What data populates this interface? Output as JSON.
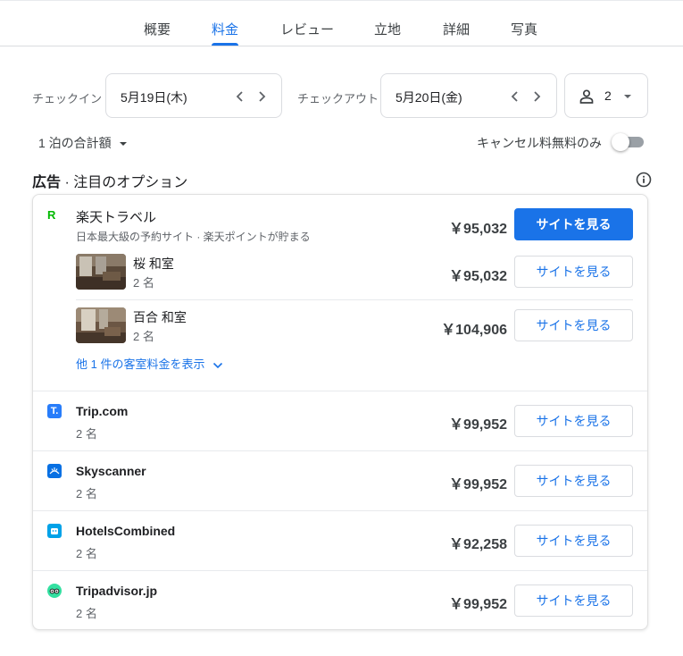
{
  "tabs": [
    {
      "label": "概要"
    },
    {
      "label": "料金"
    },
    {
      "label": "レビュー"
    },
    {
      "label": "立地"
    },
    {
      "label": "詳細"
    },
    {
      "label": "写真"
    }
  ],
  "dates": {
    "checkin_label": "チェックイン",
    "checkin_value": "5月19日(木)",
    "checkout_label": "チェックアウト",
    "checkout_value": "5月20日(金)"
  },
  "guests": {
    "count": "2"
  },
  "filters": {
    "total_label": "1 泊の合計額",
    "cancel_label": "キャンセル料無料のみ",
    "cancel_enabled": false
  },
  "section": {
    "ad_label": "広告",
    "separator": " · ",
    "title": "注目のオプション"
  },
  "featured": {
    "name": "楽天トラベル",
    "tagline": "日本最大級の予約サイト · 楽天ポイントが貯まる",
    "price": "￥95,032",
    "button": "サイトを見る",
    "rooms": [
      {
        "name": "桜 和室",
        "guests": "2 名",
        "price": "￥95,032",
        "button": "サイトを見る"
      },
      {
        "name": "百合 和室",
        "guests": "2 名",
        "price": "￥104,906",
        "button": "サイトを見る"
      }
    ],
    "more_link": "他 1 件の客室料金を表示"
  },
  "providers": [
    {
      "name": "Trip.com",
      "guests": "2 名",
      "price": "￥99,952",
      "button": "サイトを見る",
      "logo_color": "#287dfa"
    },
    {
      "name": "Skyscanner",
      "guests": "2 名",
      "price": "￥99,952",
      "button": "サイトを見る",
      "logo_color": "#0770e3"
    },
    {
      "name": "HotelsCombined",
      "guests": "2 名",
      "price": "￥92,258",
      "button": "サイトを見る",
      "logo_color": "#00a2e8"
    },
    {
      "name": "Tripadvisor.jp",
      "guests": "2 名",
      "price": "￥99,952",
      "button": "サイトを見る",
      "logo_color": "#34e0a1"
    }
  ],
  "colors": {
    "accent": "#1a73e8",
    "rakuten": "#00b900"
  }
}
